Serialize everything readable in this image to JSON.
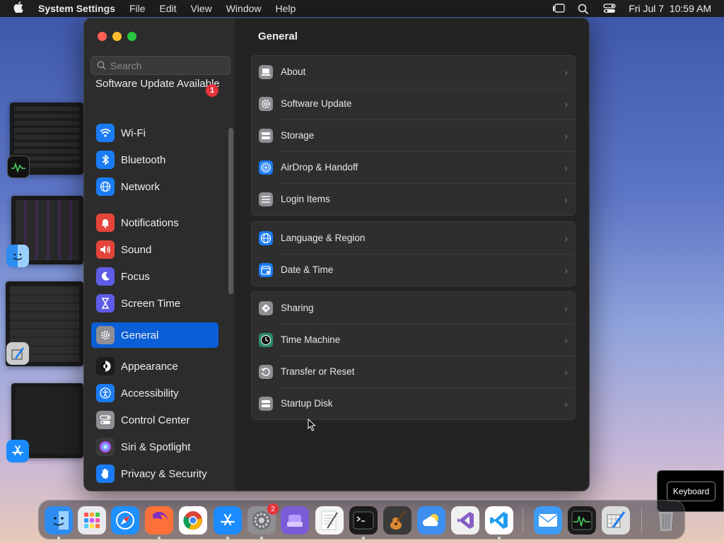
{
  "menubar": {
    "app_name": "System Settings",
    "menus": [
      "File",
      "Edit",
      "View",
      "Window",
      "Help"
    ],
    "clock": "Fri Jul 7  10:59 AM"
  },
  "sidebar": {
    "search_placeholder": "Search",
    "update_notice": "Software Update Available",
    "update_badge": "1",
    "items": [
      {
        "label": "Wi-Fi",
        "icon": "wifi-icon",
        "color": "#1a7cf5"
      },
      {
        "label": "Bluetooth",
        "icon": "bluetooth-icon",
        "color": "#1a7cf5"
      },
      {
        "label": "Network",
        "icon": "globe-icon",
        "color": "#1a7cf5"
      },
      {
        "label": "Notifications",
        "icon": "bell-icon",
        "color": "#e5443a"
      },
      {
        "label": "Sound",
        "icon": "speaker-icon",
        "color": "#e5443a"
      },
      {
        "label": "Focus",
        "icon": "moon-icon",
        "color": "#5e5ce6"
      },
      {
        "label": "Screen Time",
        "icon": "hourglass-icon",
        "color": "#5e5ce6"
      },
      {
        "label": "General",
        "icon": "gear-icon",
        "color": "#8e8e93",
        "selected": true
      },
      {
        "label": "Appearance",
        "icon": "appearance-icon",
        "color": "#1c1c1e"
      },
      {
        "label": "Accessibility",
        "icon": "accessibility-icon",
        "color": "#1a7cf5"
      },
      {
        "label": "Control Center",
        "icon": "control-center-icon",
        "color": "#8e8e93"
      },
      {
        "label": "Siri & Spotlight",
        "icon": "siri-icon",
        "color": "#3a3a3c"
      },
      {
        "label": "Privacy & Security",
        "icon": "hand-icon",
        "color": "#1a7cf5"
      }
    ]
  },
  "content": {
    "title": "General",
    "groups": [
      [
        {
          "label": "About",
          "icon": "laptop-icon",
          "color": "#8e8e93"
        },
        {
          "label": "Software Update",
          "icon": "gear-icon",
          "color": "#8e8e93"
        },
        {
          "label": "Storage",
          "icon": "disk-icon",
          "color": "#8e8e93"
        },
        {
          "label": "AirDrop & Handoff",
          "icon": "airdrop-icon",
          "color": "#1a7cf5"
        },
        {
          "label": "Login Items",
          "icon": "list-icon",
          "color": "#8e8e93"
        }
      ],
      [
        {
          "label": "Language & Region",
          "icon": "globe-icon",
          "color": "#1a7cf5"
        },
        {
          "label": "Date & Time",
          "icon": "calendar-icon",
          "color": "#1a7cf5"
        }
      ],
      [
        {
          "label": "Sharing",
          "icon": "sharing-icon",
          "color": "#8e8e93"
        },
        {
          "label": "Time Machine",
          "icon": "clock-icon",
          "color": "#2c8a6a"
        },
        {
          "label": "Transfer or Reset",
          "icon": "reset-icon",
          "color": "#8e8e93"
        },
        {
          "label": "Startup Disk",
          "icon": "disk-icon",
          "color": "#8e8e93"
        }
      ]
    ]
  },
  "tooltip": {
    "label": "Keyboard"
  },
  "dock": {
    "apps": [
      {
        "icon": "finder-icon",
        "color": "#2d8cf0",
        "dot": true
      },
      {
        "icon": "launchpad-icon",
        "color": "#e9e9ee",
        "dot": false
      },
      {
        "icon": "safari-icon",
        "color": "#1e90ff",
        "dot": false
      },
      {
        "icon": "firefox-icon",
        "color": "#ff7139",
        "dot": true
      },
      {
        "icon": "chrome-icon",
        "color": "#ffffff",
        "dot": false
      },
      {
        "icon": "app-store-icon",
        "color": "#1a8cff",
        "dot": true
      },
      {
        "icon": "system-settings-icon",
        "color": "#8e8e93",
        "dot": true,
        "badge": "2"
      },
      {
        "icon": "stack-icon",
        "color": "#7b5cd6",
        "dot": false
      },
      {
        "icon": "textedit-icon",
        "color": "#f5f5f5",
        "dot": false
      },
      {
        "icon": "terminal-icon",
        "color": "#1c1c1c",
        "dot": true
      },
      {
        "icon": "garageband-icon",
        "color": "#3a3a3a",
        "dot": false
      },
      {
        "icon": "weather-icon",
        "color": "#3d8ff0",
        "dot": false
      },
      {
        "icon": "visual-studio-icon",
        "color": "#f0f0f0",
        "dot": false
      },
      {
        "icon": "vscode-icon",
        "color": "#ffffff",
        "dot": true
      },
      {
        "icon": "mail-icon",
        "color": "#3d9cf5",
        "dot": false
      },
      {
        "icon": "activity-monitor-icon",
        "color": "#1c1c1c",
        "dot": false
      },
      {
        "icon": "scripteditor-icon",
        "color": "#dddddd",
        "dot": false
      },
      {
        "icon": "trash-icon",
        "color": "#888888",
        "dot": false
      }
    ]
  }
}
